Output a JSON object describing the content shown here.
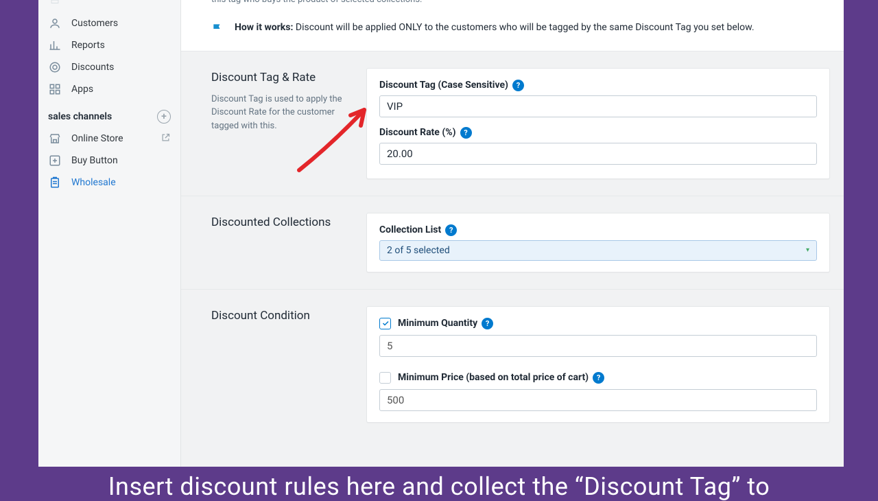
{
  "sidebar": {
    "nav": [
      {
        "label": "Customers",
        "icon": "user-icon"
      },
      {
        "label": "Reports",
        "icon": "chart-icon"
      },
      {
        "label": "Discounts",
        "icon": "tag-icon"
      },
      {
        "label": "Apps",
        "icon": "grid-icon"
      }
    ],
    "section_label": "sales channels",
    "channels": [
      {
        "label": "Online Store",
        "icon": "store-icon",
        "external": true
      },
      {
        "label": "Buy Button",
        "icon": "plus-square-icon"
      },
      {
        "label": "Wholesale",
        "icon": "clipboard-icon",
        "active": true
      }
    ]
  },
  "header": {
    "truncated_desc": "this tag who buys the product of selected collections.",
    "hiw_label": "How it works:",
    "hiw_text": "Discount will be applied ONLY to the customers who will be tagged by the same Discount Tag you set below."
  },
  "tag_rate": {
    "title": "Discount Tag & Rate",
    "help": "Discount Tag is used to apply the Discount Rate for the customer tagged with this.",
    "tag_label": "Discount Tag (Case Sensitive)",
    "tag_value": "VIP",
    "rate_label": "Discount Rate (%)",
    "rate_value": "20.00"
  },
  "collections": {
    "title": "Discounted Collections",
    "list_label": "Collection List",
    "summary": "2 of 5 selected"
  },
  "condition": {
    "title": "Discount Condition",
    "min_qty_label": "Minimum Quantity",
    "min_qty_checked": true,
    "min_qty_value": "5",
    "min_price_label": "Minimum Price (based on total price of cart)",
    "min_price_checked": false,
    "min_price_value": "500"
  },
  "caption": "Insert discount rules here and collect the “Discount Tag” to"
}
